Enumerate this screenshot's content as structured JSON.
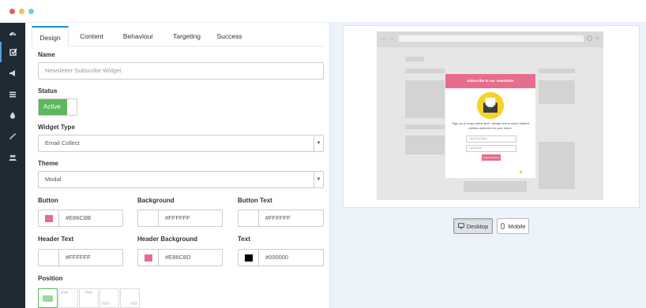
{
  "window": {
    "dots": [
      {
        "name": "close",
        "color": "#ee5a5a"
      },
      {
        "name": "minimize",
        "color": "#f6c343"
      },
      {
        "name": "zoom",
        "color": "#63d4e0"
      }
    ]
  },
  "sidebar": {
    "items": [
      {
        "icon": "dashboard-icon"
      },
      {
        "icon": "checkbox-icon",
        "active": true
      },
      {
        "icon": "megaphone-icon"
      },
      {
        "icon": "list-icon"
      },
      {
        "icon": "drop-icon"
      },
      {
        "icon": "wand-icon"
      },
      {
        "icon": "users-icon"
      }
    ]
  },
  "tabs": [
    {
      "label": "Design",
      "active": true
    },
    {
      "label": "Content"
    },
    {
      "label": "Behaviour"
    },
    {
      "label": "Targeting"
    },
    {
      "label": "Success"
    }
  ],
  "form": {
    "name_label": "Name",
    "name_placeholder": "Newsletter Subscribe Widget",
    "status_label": "Status",
    "status_value": "Active",
    "widget_type_label": "Widget Type",
    "widget_type_value": "Email Collect",
    "theme_label": "Theme",
    "theme_value": "Modal",
    "colors": {
      "button": {
        "label": "Button",
        "value": "#E86C8B",
        "swatch": "#E86C8B"
      },
      "background": {
        "label": "Background",
        "value": "#FFFFFF",
        "swatch": "#FFFFFF"
      },
      "button_text": {
        "label": "Button Text",
        "value": "#FFFFFF",
        "swatch": "#FFFFFF"
      },
      "header_text": {
        "label": "Header Text",
        "value": "#FFFFFF",
        "swatch": "#FFFFFF"
      },
      "header_background": {
        "label": "Header Background",
        "value": "#E86C8D",
        "swatch": "#E86C8D"
      },
      "text": {
        "label": "Text",
        "value": "#000000",
        "swatch": "#000000"
      }
    },
    "position_label": "Position",
    "position_selected": 0
  },
  "preview": {
    "modal": {
      "header": "Subscribe to our newsletter",
      "body": "Sign up to enjoy latest tech, design and product related articles delivered to your inbox.",
      "name_placeholder": "Your First Name",
      "email_placeholder": "Your Email",
      "button": "Subscribe Now"
    },
    "devices": [
      {
        "label": "Desktop",
        "icon": "monitor-icon",
        "active": true
      },
      {
        "label": "Mobile",
        "icon": "phone-icon"
      }
    ]
  },
  "colors": {
    "accent": "#1f8dd6",
    "success": "#5cb85c",
    "brand_pink": "#E86C8D",
    "sidebar": "#1f2a33"
  }
}
